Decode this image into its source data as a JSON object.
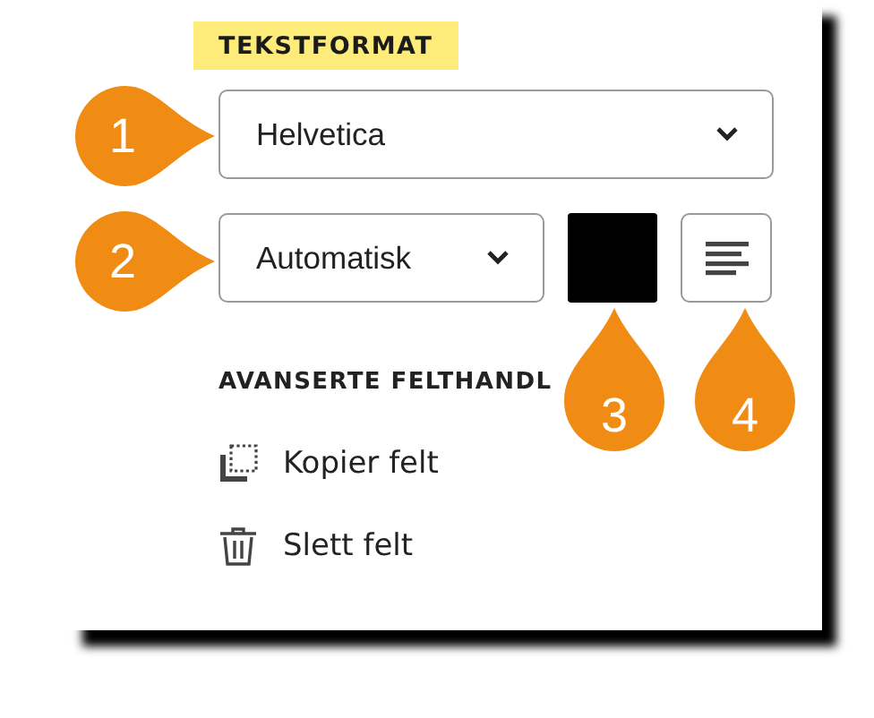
{
  "section_title": "TEKSTFORMAT",
  "font_dropdown": {
    "value": "Helvetica"
  },
  "size_dropdown": {
    "value": "Automatisk"
  },
  "color_swatch": {
    "color": "#000000"
  },
  "advanced_title": "AVANSERTE FELTHANDL",
  "actions": [
    {
      "kind": "copy",
      "label": "Kopier felt"
    },
    {
      "kind": "delete",
      "label": "Slett felt"
    }
  ],
  "callouts": [
    {
      "kind": "left",
      "label": "1"
    },
    {
      "kind": "left",
      "label": "2"
    },
    {
      "kind": "up",
      "label": "3"
    },
    {
      "kind": "up",
      "label": "4"
    }
  ]
}
